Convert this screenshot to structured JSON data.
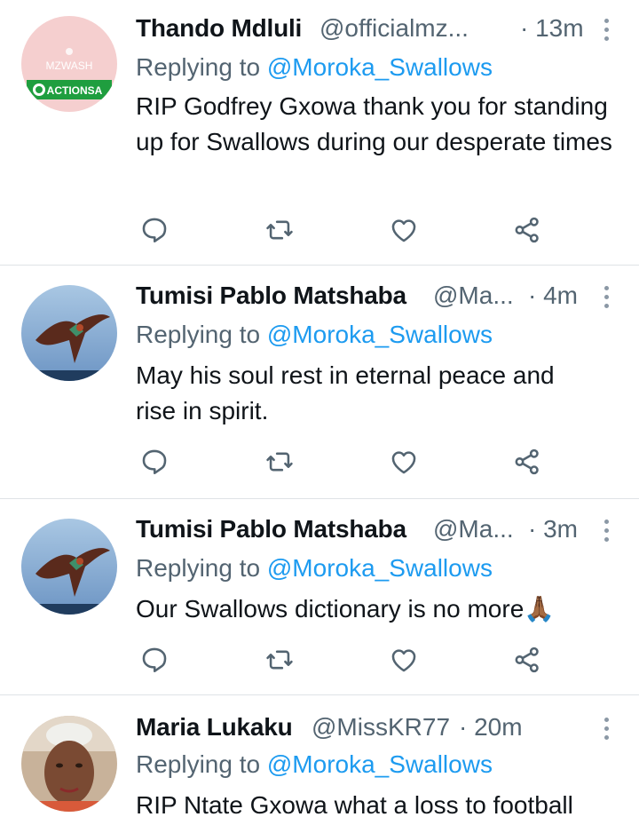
{
  "tweets": [
    {
      "name": "Thando Mdluli",
      "handle": "@officialmz...",
      "time": "· 13m",
      "reply_prefix": "Replying to ",
      "reply_to": "@Moroka_Swallows",
      "text": "RIP Godfrey Gxowa thank you for standing up for Swallows during our desperate times",
      "avatar": {
        "logo_text": "MZWASH",
        "badge_text": "ACTIONSA"
      }
    },
    {
      "name": "Tumisi Pablo Matshaba",
      "handle": "@Ma...",
      "time": "· 4m",
      "reply_prefix": "Replying to ",
      "reply_to": "@Moroka_Swallows",
      "text": "May his soul rest in eternal peace and rise in spirit."
    },
    {
      "name": "Tumisi Pablo Matshaba",
      "handle": "@Ma...",
      "time": "· 3m",
      "reply_prefix": "Replying to ",
      "reply_to": "@Moroka_Swallows",
      "text": "Our Swallows dictionary is no more🙏🏾"
    },
    {
      "name": "Maria Lukaku",
      "handle": "@MissKR77",
      "time": "· 20m",
      "reply_prefix": "Replying to ",
      "reply_to": "@Moroka_Swallows",
      "text": "RIP Ntate Gxowa what a loss to football"
    }
  ],
  "icons": {
    "reply": "reply-icon",
    "retweet": "retweet-icon",
    "like": "like-icon",
    "share": "share-icon",
    "more": "more-icon"
  },
  "colors": {
    "text": "#0f1419",
    "muted": "#536471",
    "link": "#1d9bf0",
    "divider": "#dfe3e6"
  }
}
